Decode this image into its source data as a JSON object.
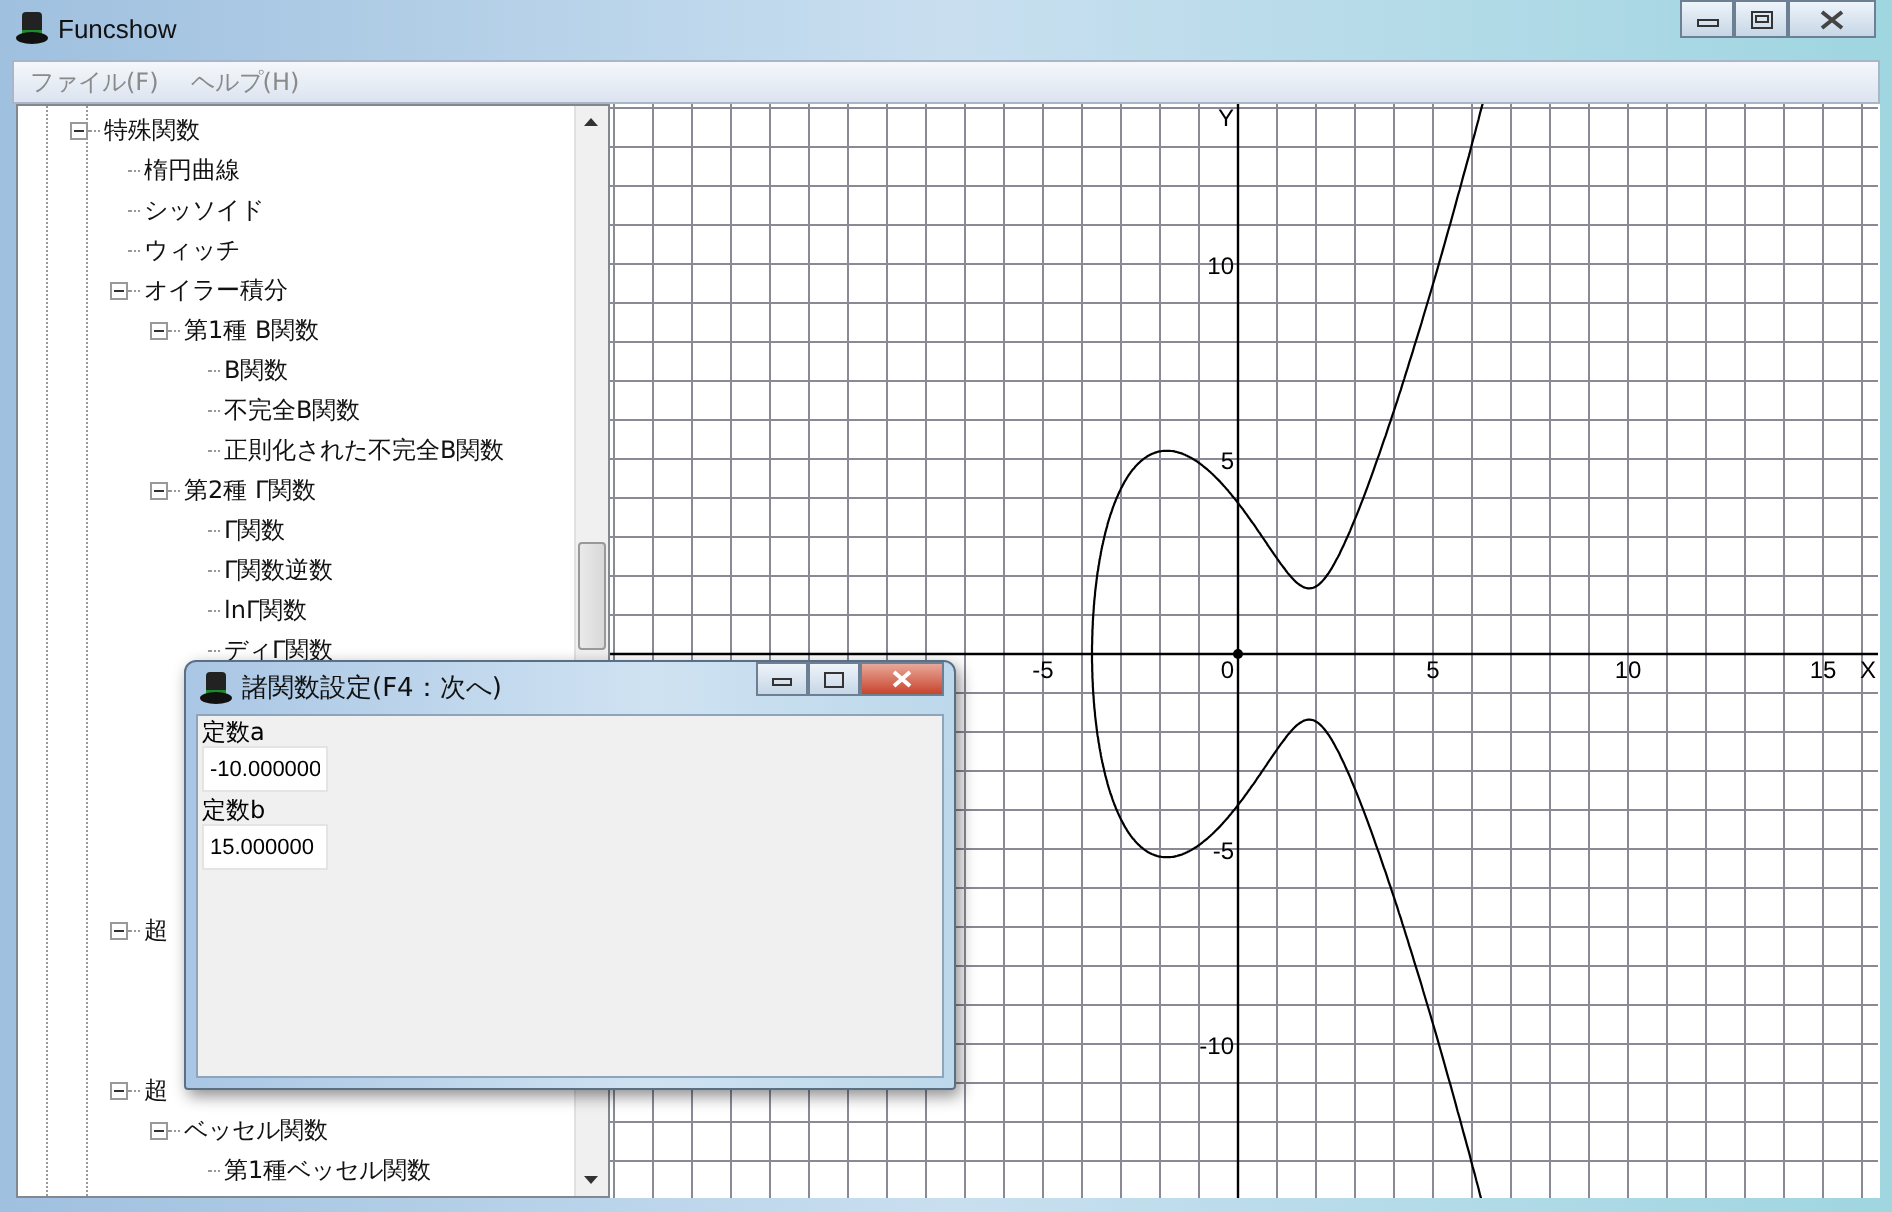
{
  "window": {
    "title": "Funcshow"
  },
  "menu": [
    {
      "label": "ファイル(F)"
    },
    {
      "label": "ヘルプ(H)"
    }
  ],
  "tree": {
    "nodes": [
      {
        "label": "特殊関数",
        "expanded": true,
        "children": [
          {
            "label": "楕円曲線"
          },
          {
            "label": "シッソイド"
          },
          {
            "label": "ウィッチ"
          },
          {
            "label": "オイラー積分",
            "expanded": true,
            "children": [
              {
                "label": "第1種 B関数",
                "expanded": true,
                "children": [
                  {
                    "label": "B関数"
                  },
                  {
                    "label": "不完全B関数"
                  },
                  {
                    "label": "正則化された不完全B関数"
                  }
                ]
              },
              {
                "label": "第2種 Γ関数",
                "expanded": true,
                "children": [
                  {
                    "label": "Γ関数"
                  },
                  {
                    "label": "Γ関数逆数"
                  },
                  {
                    "label": "lnΓ関数"
                  },
                  {
                    "label": "ディΓ関数"
                  }
                ]
              }
            ]
          },
          {
            "label": "超",
            "expanded": true
          },
          {
            "label": "超",
            "expanded": true,
            "children": [
              {
                "label": "ベッセル関数",
                "expanded": true,
                "children": [
                  {
                    "label": "第1種ベッセル関数"
                  }
                ]
              }
            ]
          }
        ]
      }
    ]
  },
  "plot": {
    "x_ticks": [
      "-5",
      "0",
      "5",
      "10",
      "15"
    ],
    "y_ticks": [
      "10",
      "5",
      "-5",
      "-10"
    ],
    "x_axis": "X",
    "y_axis": "Y"
  },
  "dialog": {
    "title": "諸関数設定(F4：次へ)",
    "fields": [
      {
        "label": "定数a",
        "value": "-10.000000"
      },
      {
        "label": "定数b",
        "value": "15.000000"
      }
    ]
  }
}
